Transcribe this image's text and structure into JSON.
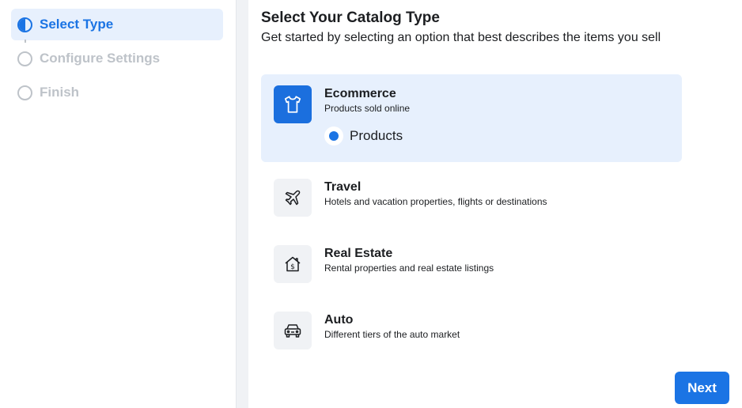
{
  "sidebar": {
    "steps": [
      {
        "label": "Select Type",
        "state": "active"
      },
      {
        "label": "Configure Settings",
        "state": "inactive"
      },
      {
        "label": "Finish",
        "state": "inactive"
      }
    ]
  },
  "main": {
    "title": "Select Your Catalog Type",
    "subtitle": "Get started by selecting an option that best describes the items you sell",
    "options": [
      {
        "title": "Ecommerce",
        "description": "Products sold online",
        "icon": "tshirt-icon",
        "selected": true,
        "radio_label": "Products"
      },
      {
        "title": "Travel",
        "description": "Hotels and vacation properties, flights or destinations",
        "icon": "airplane-icon",
        "selected": false
      },
      {
        "title": "Real Estate",
        "description": "Rental properties and real estate listings",
        "icon": "house-dollar-icon",
        "selected": false
      },
      {
        "title": "Auto",
        "description": "Different tiers of the auto market",
        "icon": "car-icon",
        "selected": false
      }
    ],
    "next_label": "Next"
  },
  "colors": {
    "accent": "#1b74e4",
    "selected_bg": "#e7f0fd",
    "inactive_text": "#bec3c9"
  }
}
